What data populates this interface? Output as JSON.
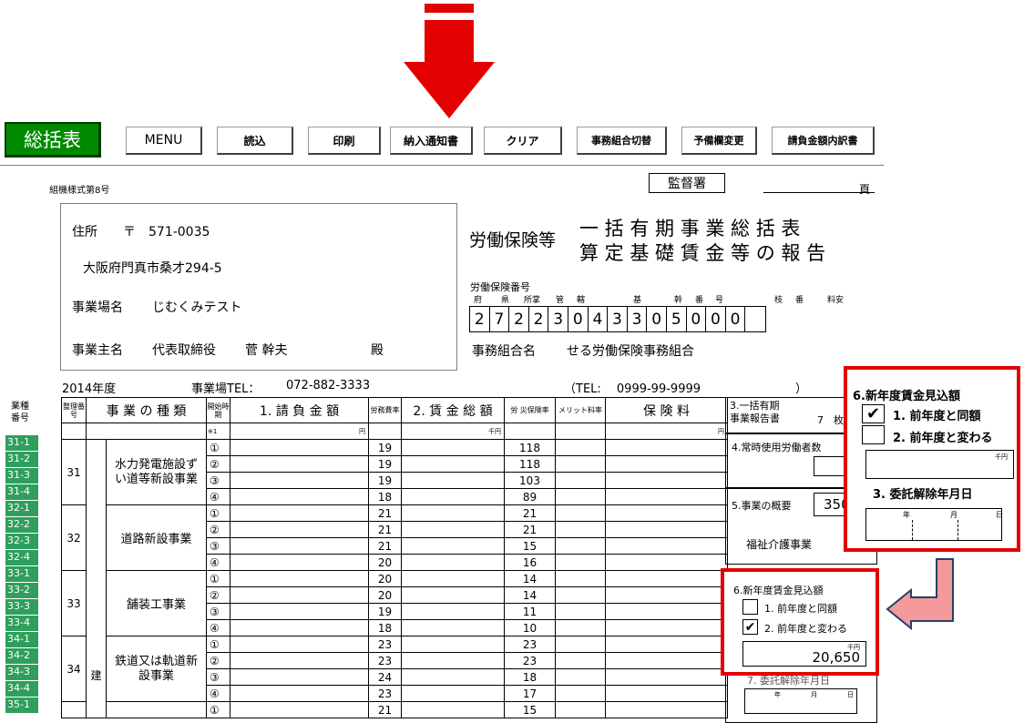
{
  "toolbar": {
    "main": "総括表",
    "buttons": [
      "MENU",
      "読込",
      "印刷",
      "納入通知書",
      "クリア",
      "事務組合切替",
      "予備欄変更",
      "請負金額内訳書"
    ]
  },
  "form": {
    "form_no": "組機様式第8号",
    "office": "監督署",
    "page": "頁",
    "title_prefix": "労働保険等",
    "title_line1": "一 括 有 期 事 業 総 括 表",
    "title_line2": "算 定 基 礎 賃 金 等 の 報 告",
    "address_label": "住所",
    "postal": "〒　571-0035",
    "address": "大阪府門真市桑才294-5",
    "site_label": "事業場名",
    "site_name": "じむくみテスト",
    "owner_label": "事業主名",
    "owner_title": "代表取締役",
    "owner_name": "菅 幹夫",
    "owner_suffix": "殿",
    "ins_no_label": "労働保険番号",
    "ins_no_heads": [
      "府",
      "県",
      "所掌",
      "管",
      "轄",
      "基",
      "幹",
      "番",
      "号",
      "枝",
      "番",
      "料安"
    ],
    "ins_no_digits": [
      "2",
      "7",
      "2",
      "2",
      "3",
      "0",
      "4",
      "3",
      "3",
      "0",
      "5",
      "0",
      "0",
      "0",
      ""
    ],
    "union_label": "事務組合名",
    "union_name": "せる労働保険事務組合",
    "year": "2014年度",
    "tel_label": "事業場TEL：",
    "tel": "072-882-3333",
    "union_tel": "（TEL:　 0999-99-9999　　　　　　　　）"
  },
  "table": {
    "side_header": "業種\n番号",
    "headers": {
      "no": "整理番号",
      "type": "事 業 の 種 類",
      "period": "開始時期",
      "contract": "1. 請 負 金 額",
      "labor": "労務費率",
      "wages": "2. 賃 金 総 額",
      "rate": "労 災保険率",
      "merit": "メリット料率",
      "premium": "保 険 料"
    },
    "period_note": "※1",
    "yen_unit": "円",
    "thousand_unit": "千円",
    "construction_label": "建",
    "groups": [
      {
        "no": "31",
        "name": "水力発電施設ずい道等新設事業",
        "rows": [
          [
            "①",
            "19",
            "118"
          ],
          [
            "②",
            "19",
            "118"
          ],
          [
            "③",
            "19",
            "103"
          ],
          [
            "④",
            "18",
            "89"
          ]
        ]
      },
      {
        "no": "32",
        "name": "道路新設事業",
        "rows": [
          [
            "①",
            "21",
            "21"
          ],
          [
            "②",
            "21",
            "21"
          ],
          [
            "③",
            "21",
            "15"
          ],
          [
            "④",
            "20",
            "16"
          ]
        ]
      },
      {
        "no": "33",
        "name": "舗装工事業",
        "rows": [
          [
            "①",
            "20",
            "14"
          ],
          [
            "②",
            "20",
            "14"
          ],
          [
            "③",
            "19",
            "11"
          ],
          [
            "④",
            "18",
            "10"
          ]
        ]
      },
      {
        "no": "34",
        "name": "鉄道又は軌道新設事業",
        "rows": [
          [
            "①",
            "23",
            "23"
          ],
          [
            "②",
            "23",
            "23"
          ],
          [
            "③",
            "24",
            "18"
          ],
          [
            "④",
            "23",
            "17"
          ]
        ]
      },
      {
        "no": "",
        "name": "",
        "rows": [
          [
            "①",
            "21",
            "15"
          ]
        ]
      }
    ],
    "side_codes": [
      "31-1",
      "31-2",
      "31-3",
      "31-4",
      "32-1",
      "32-2",
      "32-3",
      "32-4",
      "33-1",
      "33-2",
      "33-3",
      "33-4",
      "34-1",
      "34-2",
      "34-3",
      "34-4",
      "35-1"
    ]
  },
  "right_panel": {
    "item3_label": "3.一括有期\n事業報告書",
    "item3_value": "7　枚",
    "item4_label": "4.常時使用労働者数",
    "item5_label": "5.事業の概要",
    "item5_value": "350",
    "item5_text": "福祉介護事業",
    "item6_label": "6.新年度賃金見込額",
    "opt1": "1. 前年度と同額",
    "opt2": "2. 前年度と変わる",
    "item7_label": "7. 委託解除年月日",
    "amount": "20,650",
    "unit": "千円",
    "date_units": [
      "年",
      "月",
      "日"
    ]
  },
  "popup": {
    "title": "6.新年度賃金見込額",
    "opt1": "1. 前年度と同額",
    "opt2": "2. 前年度と変わる",
    "unit": "千円",
    "item3": "3. 委託解除年月日",
    "date_units": [
      "年",
      "月",
      "日"
    ]
  },
  "colors": {
    "accent": "#e30000",
    "green": "#008a00",
    "side": "#2f9f5c",
    "arrow_pink": "#f49a9a"
  }
}
